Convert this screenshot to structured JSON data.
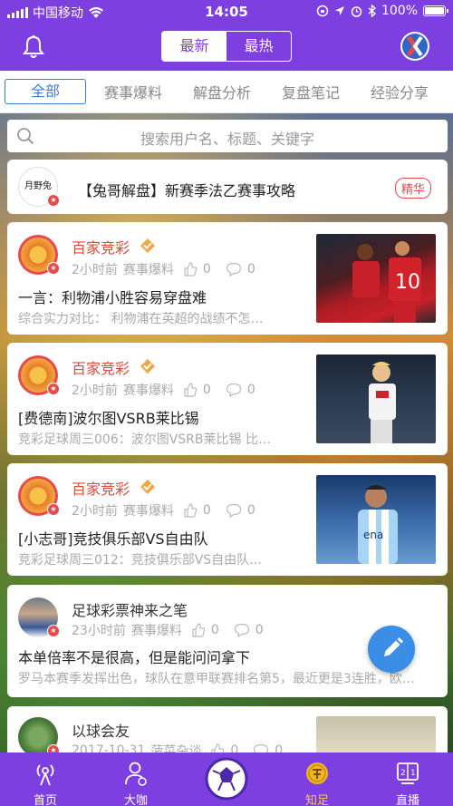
{
  "status": {
    "carrier": "中国移动",
    "time": "14:05",
    "battery": "100%"
  },
  "header": {
    "seg_latest": "最新",
    "seg_hot": "最热"
  },
  "tabs": [
    "全部",
    "赛事爆料",
    "解盘分析",
    "复盘笔记",
    "经验分享"
  ],
  "search": {
    "placeholder": "搜索用户名、标题、关键字"
  },
  "pinned": {
    "avatar_text": "月野兔",
    "title": "【兔哥解盘】新赛季法乙赛事攻略",
    "badge": "精华"
  },
  "posts": [
    {
      "author": "百家竞彩",
      "time": "2小时前",
      "category": "赛事爆料",
      "likes": "0",
      "comments": "0",
      "title": "一言：利物浦小胜容易穿盘难",
      "summary": "综合实力对比：    利物浦在英超的战绩不怎…"
    },
    {
      "author": "百家竞彩",
      "time": "2小时前",
      "category": "赛事爆料",
      "likes": "0",
      "comments": "0",
      "title": "[费德南]波尔图VSRB莱比锡",
      "summary": "竞彩足球周三006：波尔图VSRB莱比锡      比…"
    },
    {
      "author": "百家竞彩",
      "time": "2小时前",
      "category": "赛事爆料",
      "likes": "0",
      "comments": "0",
      "title": "[小志哥]竞技俱乐部VS自由队",
      "summary": "竞彩足球周三012：竞技俱乐部VS自由队…"
    },
    {
      "author": "足球彩票神来之笔",
      "time": "23小时前",
      "category": "赛事爆料",
      "likes": "0",
      "comments": "0",
      "title": "本单倍率不是很高，但是能问问拿下",
      "summary": "罗马本赛季发挥出色，球队在意甲联赛排名第5，最近更是3连胜，欧…"
    },
    {
      "author": "以球会友",
      "time": "2017-10-31",
      "category": "菠菜杂谈",
      "likes": "0",
      "comments": "0"
    }
  ],
  "tabbar": [
    "首页",
    "大咖",
    "",
    "知足",
    "直播"
  ],
  "colors": {
    "brand": "#7d3fe0",
    "accent": "#3a7fe0",
    "author_red": "#e24a3a"
  }
}
